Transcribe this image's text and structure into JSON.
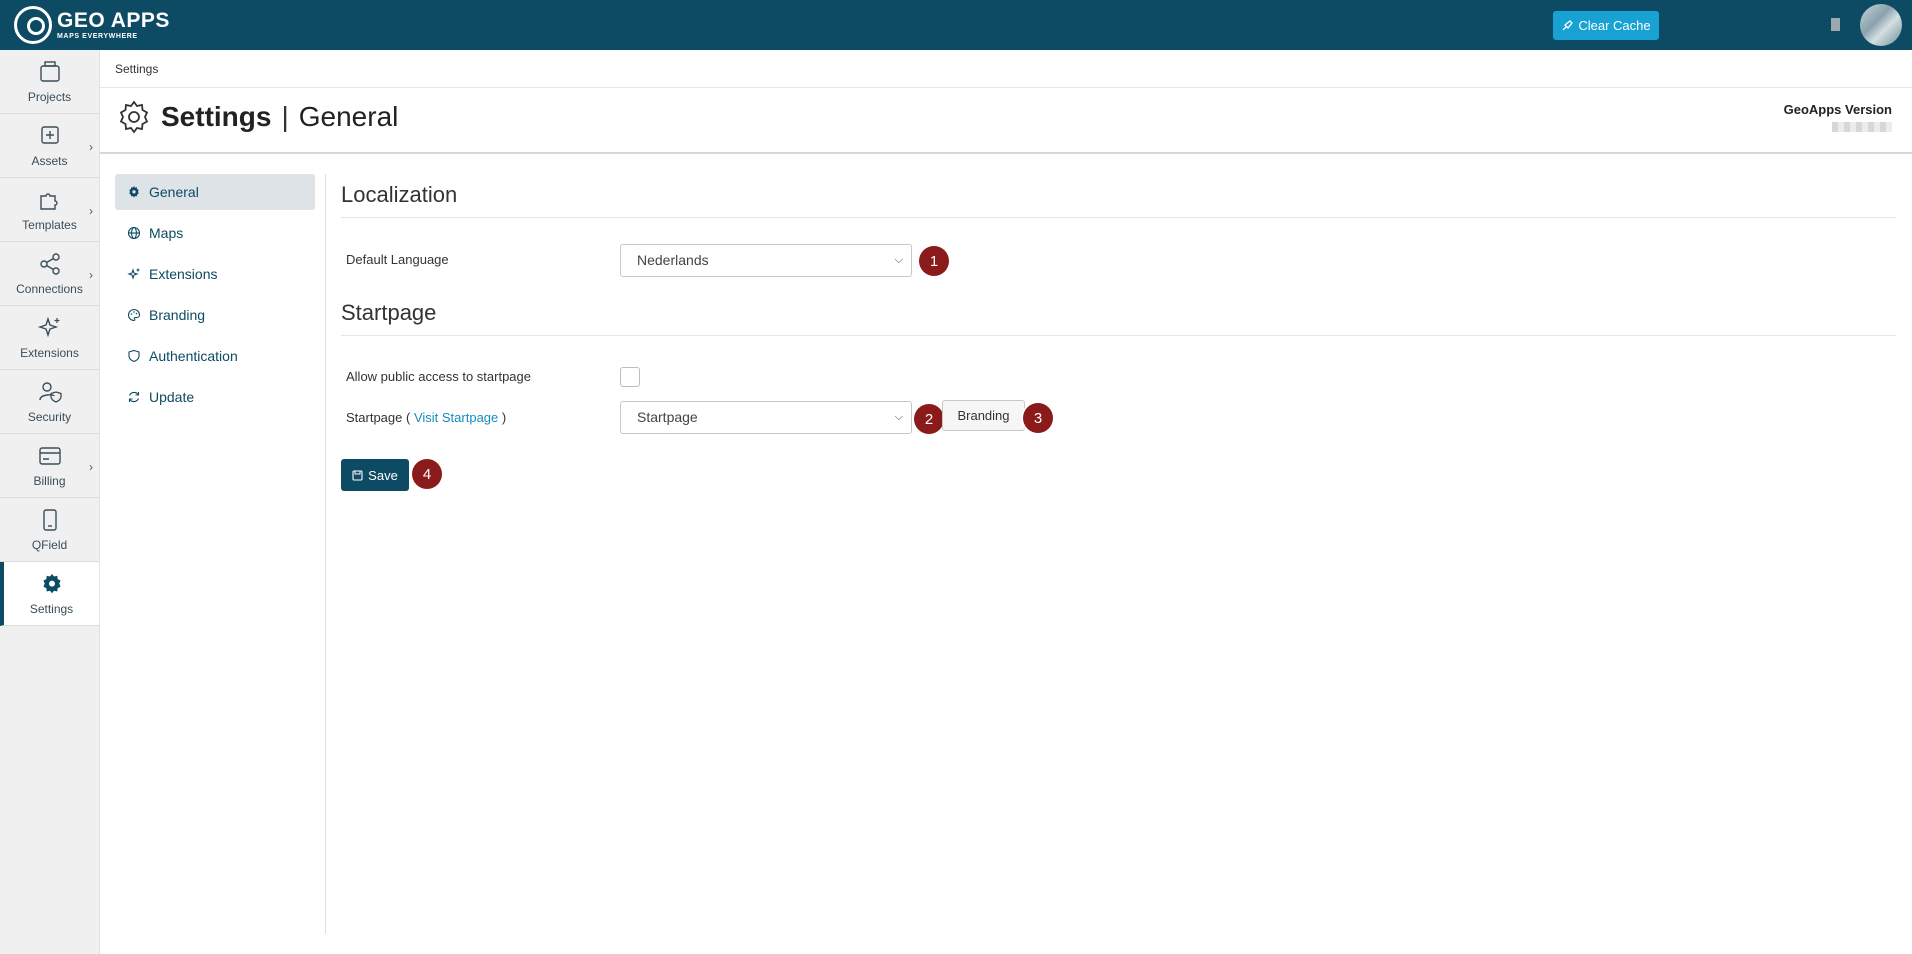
{
  "app": {
    "logo_title": "GEO APPS",
    "logo_subtitle": "MAPS EVERYWHERE",
    "clear_cache_label": "Clear Cache"
  },
  "rail": {
    "items": [
      {
        "label": "Projects",
        "icon": "briefcase-icon",
        "chevron": false
      },
      {
        "label": "Assets",
        "icon": "plus-square-icon",
        "chevron": true
      },
      {
        "label": "Templates",
        "icon": "puzzle-icon",
        "chevron": true
      },
      {
        "label": "Connections",
        "icon": "share-nodes-icon",
        "chevron": true
      },
      {
        "label": "Extensions",
        "icon": "sparkles-icon",
        "chevron": false
      },
      {
        "label": "Security",
        "icon": "user-shield-icon",
        "chevron": false
      },
      {
        "label": "Billing",
        "icon": "credit-card-icon",
        "chevron": true
      },
      {
        "label": "QField",
        "icon": "phone-icon",
        "chevron": false
      },
      {
        "label": "Settings",
        "icon": "gear-icon",
        "chevron": false,
        "active": true
      }
    ]
  },
  "breadcrumb": "Settings",
  "header": {
    "title": "Settings",
    "separator": "|",
    "subtitle": "General",
    "version_label": "GeoApps Version"
  },
  "settings_nav": {
    "items": [
      {
        "label": "General",
        "icon": "gear-icon",
        "active": true
      },
      {
        "label": "Maps",
        "icon": "globe-icon"
      },
      {
        "label": "Extensions",
        "icon": "sparkles-icon"
      },
      {
        "label": "Branding",
        "icon": "palette-icon"
      },
      {
        "label": "Authentication",
        "icon": "shield-icon"
      },
      {
        "label": "Update",
        "icon": "refresh-icon"
      }
    ]
  },
  "localization": {
    "title": "Localization",
    "default_language_label": "Default Language",
    "default_language_value": "Nederlands"
  },
  "startpage": {
    "title": "Startpage",
    "public_access_label": "Allow public access to startpage",
    "public_access_checked": false,
    "startpage_label_prefix": "Startpage (",
    "visit_link": "Visit Startpage",
    "startpage_label_suffix": ")",
    "startpage_value": "Startpage",
    "branding_button": "Branding"
  },
  "save_label": "Save",
  "annotations": [
    "1",
    "2",
    "3",
    "4"
  ],
  "colors": {
    "topbar": "#0d4a63",
    "accent": "#17a2d3",
    "badge": "#8b1a1a"
  }
}
